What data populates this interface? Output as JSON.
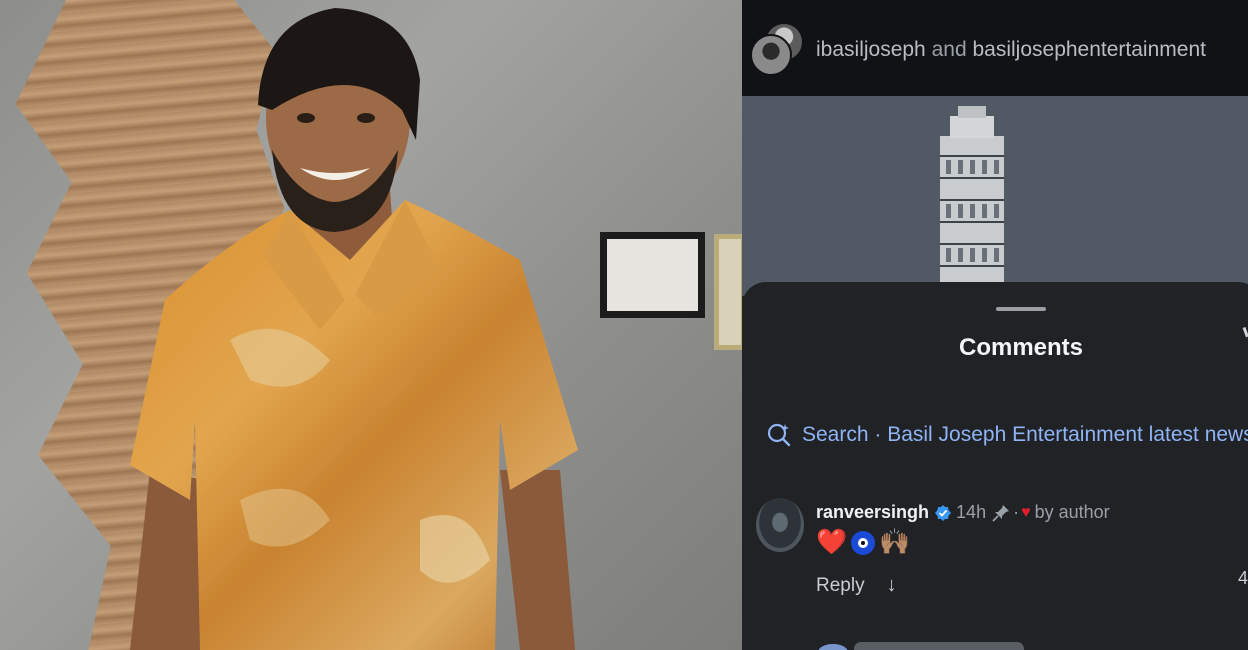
{
  "header": {
    "user_a": "ibasiljoseph",
    "connector": "and",
    "user_b": "basiljosephentertainment"
  },
  "comments_sheet": {
    "title": "Comments",
    "search_text": "Search · Basil Joseph Entertainment latest news"
  },
  "comment": {
    "username": "ranveersingh",
    "time": "14h",
    "separator": "·",
    "liked_by": "by author",
    "emoji_heart": "❤️",
    "emoji_raised_hands": "🙌🏽",
    "reply_label": "Reply",
    "like_count": "4"
  },
  "colors": {
    "accent_blue": "#8fb4f5",
    "verified_blue": "#3897f0",
    "heart_red": "#e0202c",
    "sheet_bg": "#202226"
  }
}
